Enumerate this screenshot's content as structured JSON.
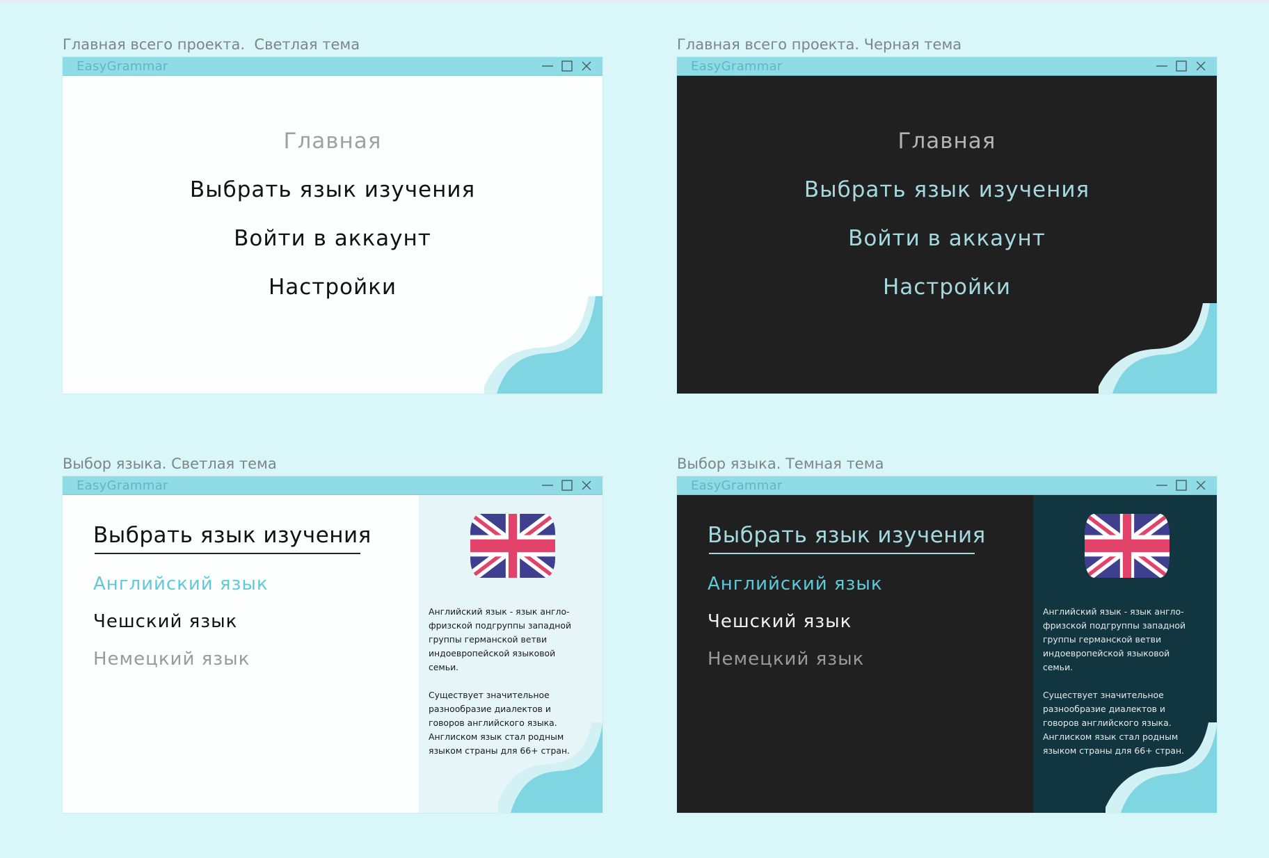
{
  "frames": [
    {
      "label": "Главная всего проекта.  Светлая тема",
      "title": "EasyGrammar",
      "menu": [
        "Главная",
        "Выбрать язык изучения",
        "Войти в аккаунт",
        "Настройки"
      ]
    },
    {
      "label": "Главная всего проекта. Черная тема",
      "title": "EasyGrammar",
      "menu": [
        "Главная",
        "Выбрать язык изучения",
        "Войти в аккаунт",
        "Настройки"
      ]
    },
    {
      "label": "Выбор языка. Светлая тема",
      "title": "EasyGrammar",
      "heading": "Выбрать язык изучения",
      "languages": [
        "Английский язык",
        "Чешский язык",
        "Немецкий язык"
      ],
      "description": "Английский язык  - язык англо-\nфризской подгруппы западной\nгруппы германской ветви\nиндоевропейской языковой\nсемьи.\n\nСуществует значительное\nразнообразие диалектов и\nговоров английского языка.\nАнглиском язык стал родным\nязыком страны для  66+ стран."
    },
    {
      "label": "Выбор языка. Темная тема",
      "title": "EasyGrammar",
      "heading": "Выбрать язык изучения",
      "languages": [
        "Английский язык",
        "Чешский язык",
        "Немецкий язык"
      ],
      "description": "Английский язык  - язык англо-\nфризской подгруппы западной\nгруппы германской ветви\nиндоевропейской языковой\nсемьи.\n\nСуществует значительное\nразнообразие диалектов и\nговоров английского языка.\nАнглиском язык стал родным\nязыком страны для  66+ стран."
    }
  ],
  "icons": {
    "window_controls": [
      "minimize-icon",
      "maximize-icon",
      "close-icon"
    ],
    "flag": "uk-flag-icon"
  },
  "colors": {
    "canvas_background": "#d9f6f9",
    "titlebar": "#8fdce6",
    "accent": "#5ecad8",
    "wave": "#7fd6e2",
    "light_body": "#fcfffe",
    "dark_body": "#202020",
    "dark_panel": "#12363f",
    "light_panel": "#e5f5f8"
  }
}
